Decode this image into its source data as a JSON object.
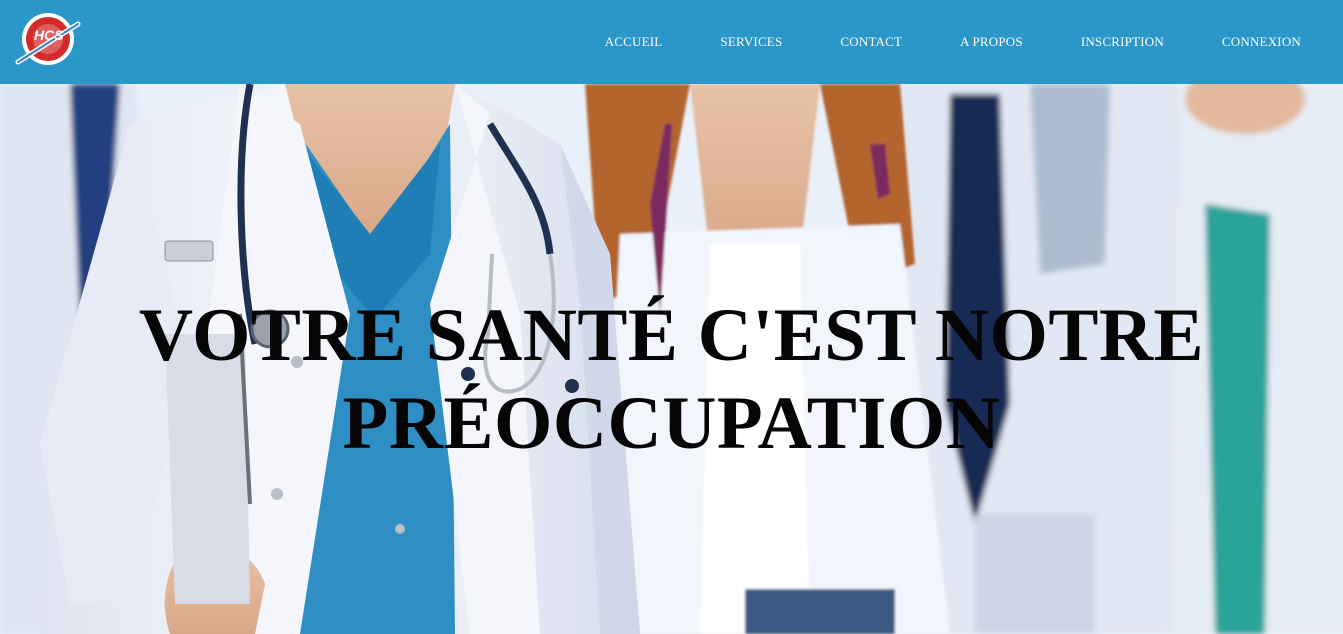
{
  "header": {
    "logo_text": "HCS",
    "bg_color": "#2b97c8",
    "nav": [
      {
        "label": "ACCUEIL"
      },
      {
        "label": "SERVICES"
      },
      {
        "label": "CONTACT"
      },
      {
        "label": "A PROPOS"
      },
      {
        "label": "INSCRIPTION"
      },
      {
        "label": "CONNEXION"
      }
    ]
  },
  "hero": {
    "title_line1": "VOTRE SANTÉ C'EST NOTRE",
    "title_line2": "PRÉOCCUPATION"
  }
}
